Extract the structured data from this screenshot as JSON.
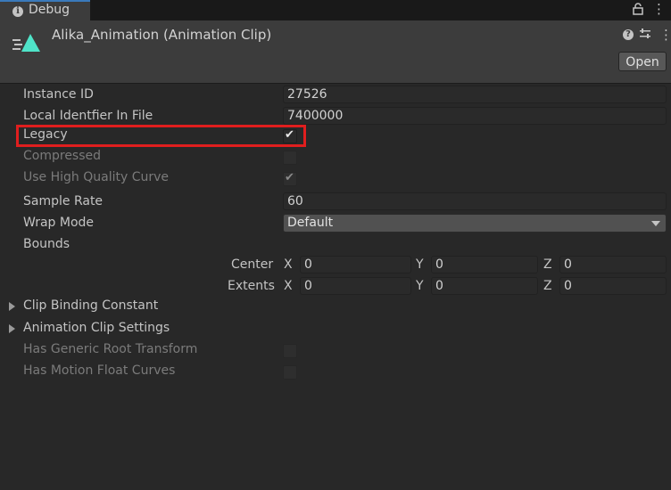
{
  "tab": {
    "label": "Debug",
    "info_icon": "i",
    "lock_icon": "lock-icon",
    "menu_icon": "⋮"
  },
  "header": {
    "title": "Alika_Animation (Animation Clip)",
    "help_icon": "?",
    "menu_icon": "⋮",
    "open_label": "Open"
  },
  "fields": {
    "instance_id": {
      "label": "Instance ID",
      "value": "27526"
    },
    "local_id": {
      "label": "Local Identfier In File",
      "value": "7400000"
    },
    "legacy": {
      "label": "Legacy",
      "checked": true
    },
    "compressed": {
      "label": "Compressed",
      "checked": false
    },
    "high_quality": {
      "label": "Use High Quality Curve",
      "checked": true
    },
    "sample_rate": {
      "label": "Sample Rate",
      "value": "60"
    },
    "wrap_mode": {
      "label": "Wrap Mode",
      "value": "Default"
    },
    "bounds": {
      "label": "Bounds"
    },
    "center": {
      "label": "Center",
      "x_label": "X",
      "x": "0",
      "y_label": "Y",
      "y": "0",
      "z_label": "Z",
      "z": "0"
    },
    "extents": {
      "label": "Extents",
      "x_label": "X",
      "x": "0",
      "y_label": "Y",
      "y": "0",
      "z_label": "Z",
      "z": "0"
    },
    "clip_binding": {
      "label": "Clip Binding Constant"
    },
    "clip_settings": {
      "label": "Animation Clip Settings"
    },
    "generic_root": {
      "label": "Has Generic Root Transform",
      "checked": false
    },
    "motion_float": {
      "label": "Has Motion Float Curves",
      "checked": false
    }
  },
  "check_glyph": "✔",
  "colors": {
    "highlight": "#e01e1e",
    "tab_accent": "#3a79bb",
    "asset_icon": "#4fe3c8"
  }
}
